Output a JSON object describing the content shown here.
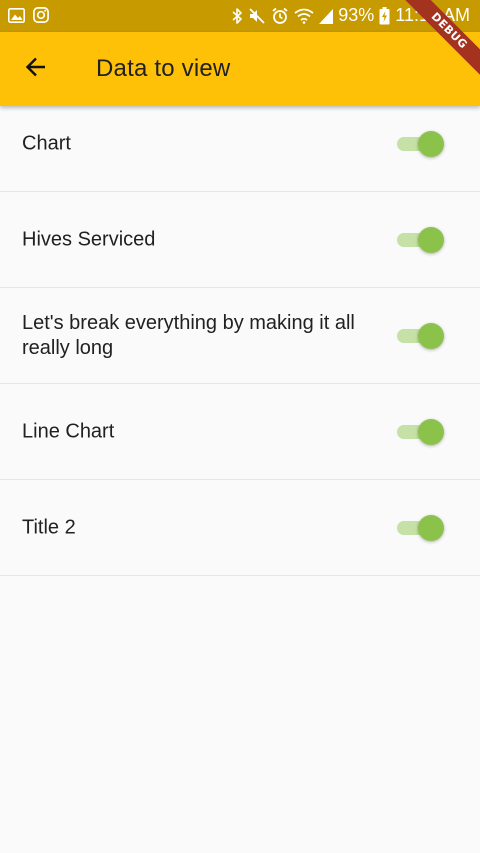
{
  "status_bar": {
    "battery_pct": "93%",
    "time": "11:12 AM",
    "icons": [
      "gallery-icon",
      "instagram-icon",
      "bluetooth-icon",
      "mute-icon",
      "alarm-icon",
      "wifi-icon",
      "signal-icon",
      "battery-icon"
    ]
  },
  "app_bar": {
    "title": "Data to view",
    "back_icon": "arrow-back-icon",
    "debug_label": "DEBUG"
  },
  "items": [
    {
      "label": "Chart",
      "enabled": true
    },
    {
      "label": "Hives Serviced",
      "enabled": true
    },
    {
      "label": "Let's break everything by making it all really long",
      "enabled": true
    },
    {
      "label": "Line Chart",
      "enabled": true
    },
    {
      "label": "Title 2",
      "enabled": true
    }
  ],
  "colors": {
    "app_bar": "#ffc107",
    "status_bar": "#c79a00",
    "switch_thumb": "#8bc34a",
    "switch_track": "#c5e1a5",
    "debug_ribbon": "#a3321e"
  }
}
